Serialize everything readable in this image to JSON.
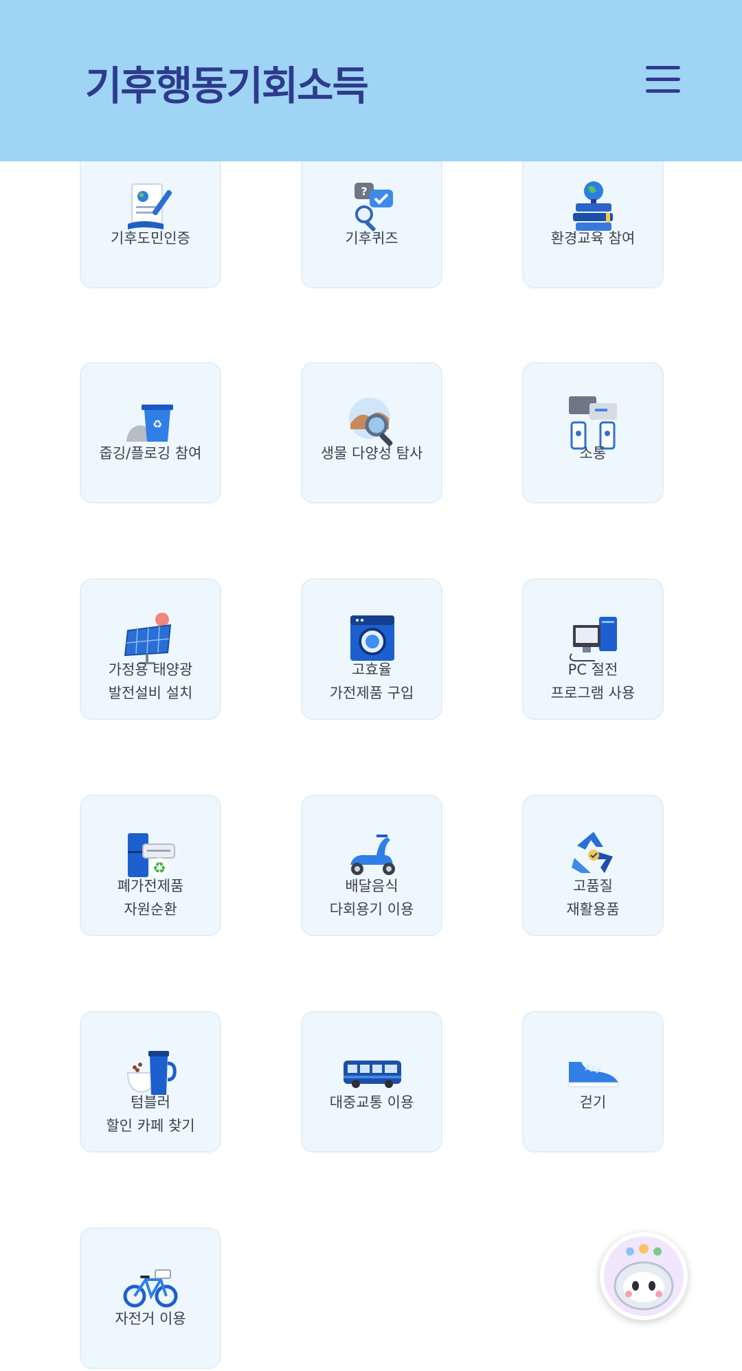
{
  "header": {
    "logo_text": "기후행동기회소득",
    "menu_icon": "hamburger-menu-icon",
    "background": "#9fd4f4",
    "logo_color": "#2e3a8c"
  },
  "cards": [
    {
      "icon": "certificate-icon",
      "lines": [
        "기후도민인증"
      ]
    },
    {
      "icon": "quiz-icon",
      "lines": [
        "기후퀴즈"
      ]
    },
    {
      "icon": "globe-books-icon",
      "lines": [
        "환경교육 참여"
      ]
    },
    {
      "icon": "recycle-bin-icon",
      "lines": [
        "줍깅/플로깅 참여"
      ]
    },
    {
      "icon": "biodiversity-magnifier-icon",
      "lines": [
        "생물 다양성 탐사"
      ]
    },
    {
      "icon": "chat-phones-icon",
      "lines": [
        "소통"
      ]
    },
    {
      "icon": "solar-panel-icon",
      "lines": [
        "가정용 태양광",
        "발전설비 설치"
      ]
    },
    {
      "icon": "washing-machine-icon",
      "lines": [
        "고효율",
        "가전제품 구입"
      ]
    },
    {
      "icon": "computer-icon",
      "lines": [
        "PC 절전",
        "프로그램 사용"
      ]
    },
    {
      "icon": "appliance-recycle-icon",
      "lines": [
        "폐가전제품",
        "자원순환"
      ]
    },
    {
      "icon": "delivery-scooter-icon",
      "lines": [
        "배달음식",
        "다회용기 이용"
      ]
    },
    {
      "icon": "recycle-arrows-icon",
      "lines": [
        "고품질",
        "재활용품"
      ]
    },
    {
      "icon": "tumbler-cup-icon",
      "lines": [
        "텀블러",
        "할인 카페 찾기"
      ]
    },
    {
      "icon": "bus-icon",
      "lines": [
        "대중교통 이용"
      ]
    },
    {
      "icon": "sneaker-icon",
      "lines": [
        "걷기"
      ]
    },
    {
      "icon": "bicycle-icon",
      "lines": [
        "자전거 이용"
      ]
    }
  ],
  "fab": {
    "icon": "chatbot-mascot-icon"
  }
}
